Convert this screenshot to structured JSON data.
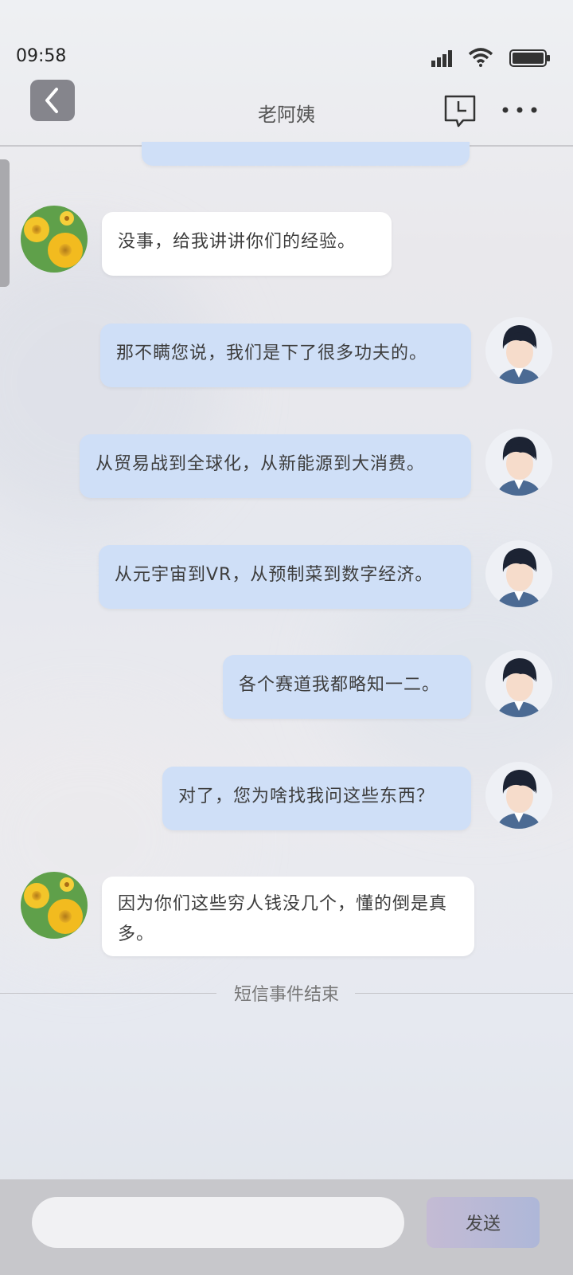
{
  "status_bar": {
    "time": "09:58"
  },
  "header": {
    "title": "老阿姨"
  },
  "messages": [
    {
      "side": "left",
      "text": "没事，给我讲讲你们的经验。"
    },
    {
      "side": "right",
      "text": "那不瞒您说，我们是下了很多功夫的。"
    },
    {
      "side": "right",
      "text": "从贸易战到全球化，从新能源到大消费。"
    },
    {
      "side": "right",
      "text": "从元宇宙到VR，从预制菜到数字经济。"
    },
    {
      "side": "right",
      "text": "各个赛道我都略知一二。"
    },
    {
      "side": "right",
      "text": "对了，您为啥找我问这些东西？"
    },
    {
      "side": "left",
      "text": "因为你们这些穷人钱没几个，懂的倒是真多。"
    }
  ],
  "divider": {
    "text": "短信事件结束"
  },
  "composer": {
    "input_value": "",
    "send_label": "发送"
  },
  "colors": {
    "left_bubble": "#ffffff",
    "right_bubble": "#cfdff7",
    "back_button": "#85858c"
  }
}
